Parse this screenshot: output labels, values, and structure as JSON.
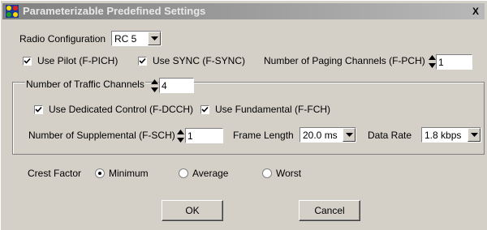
{
  "window": {
    "title": "Parameterizable Predefined Settings",
    "close_glyph": "X"
  },
  "radio_config": {
    "label": "Radio Configuration",
    "value": "RC 5"
  },
  "use_pilot": {
    "label": "Use Pilot (F-PICH)",
    "checked": true
  },
  "use_sync": {
    "label": "Use SYNC (F-SYNC)",
    "checked": true
  },
  "paging": {
    "label": "Number of Paging Channels (F-PCH)",
    "value": "1"
  },
  "traffic": {
    "label": "Number of Traffic Channels",
    "value": "4",
    "use_dcch": {
      "label": "Use Dedicated Control (F-DCCH)",
      "checked": true
    },
    "use_fch": {
      "label": "Use Fundamental (F-FCH)",
      "checked": true
    },
    "supplemental": {
      "label": "Number of Supplemental (F-SCH)",
      "value": "1"
    },
    "frame_length": {
      "label": "Frame Length",
      "value": "20.0 ms"
    },
    "data_rate": {
      "label": "Data Rate",
      "value": "1.8 kbps"
    }
  },
  "crest": {
    "label": "Crest Factor",
    "options": [
      "Minimum",
      "Average",
      "Worst"
    ],
    "selected": "Minimum"
  },
  "buttons": {
    "ok": "OK",
    "cancel": "Cancel"
  }
}
